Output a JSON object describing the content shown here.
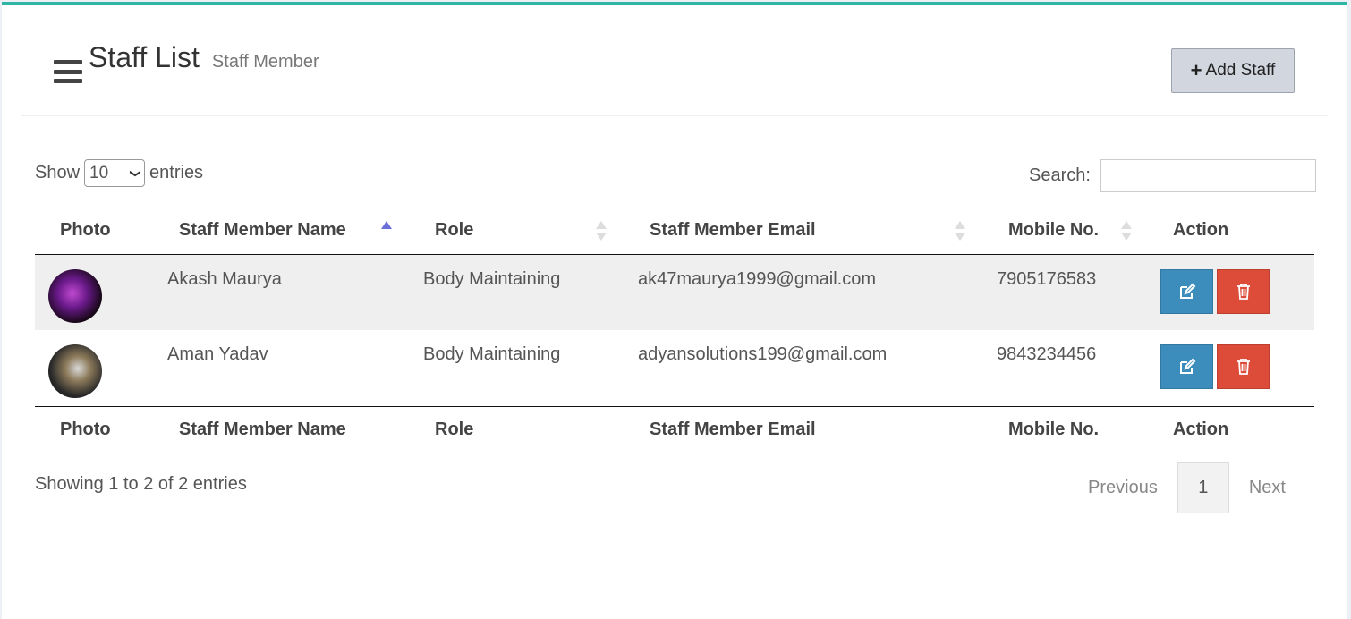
{
  "header": {
    "title": "Staff List",
    "subtitle": "Staff Member",
    "add_button_label": "Add Staff"
  },
  "controls": {
    "show_label": "Show",
    "entries_value": "10",
    "entries_label": "entries",
    "search_label": "Search:",
    "search_value": ""
  },
  "table": {
    "columns": [
      "Photo",
      "Staff Member Name",
      "Role",
      "Staff Member Email",
      "Mobile No.",
      "Action"
    ],
    "rows": [
      {
        "name": "Akash Maurya",
        "role": "Body Maintaining",
        "email": "ak47maurya1999@gmail.com",
        "mobile": "7905176583"
      },
      {
        "name": "Aman Yadav",
        "role": "Body Maintaining",
        "email": "adyansolutions199@gmail.com",
        "mobile": "9843234456"
      }
    ]
  },
  "footer": {
    "info": "Showing 1 to 2 of 2 entries",
    "prev_label": "Previous",
    "current_page": "1",
    "next_label": "Next"
  },
  "colors": {
    "accent_top": "#2fb5a3",
    "edit": "#3c8dbc",
    "delete": "#dd4b39",
    "sort_active": "#6b6fd8"
  }
}
